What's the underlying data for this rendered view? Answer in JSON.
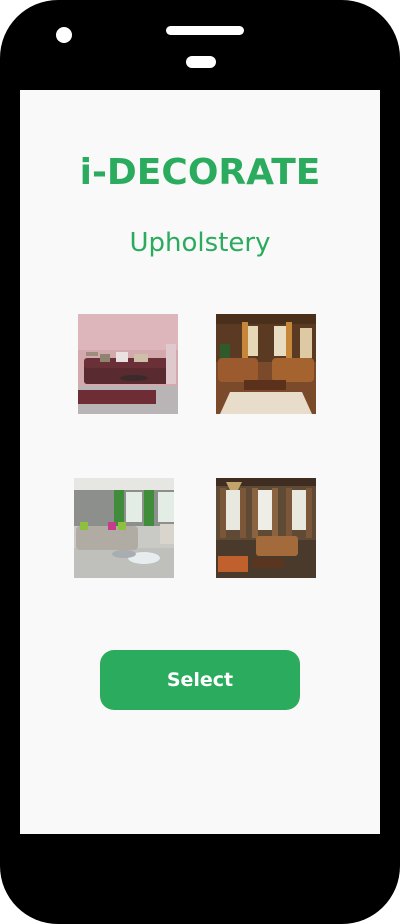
{
  "app": {
    "title": "i-DECORATE",
    "subtitle": "Upholstery"
  },
  "gallery": {
    "items": [
      {
        "icon": "pink-living-room-image"
      },
      {
        "icon": "leather-sofa-room-image"
      },
      {
        "icon": "green-accent-living-room-image"
      },
      {
        "icon": "classic-drapes-room-image"
      }
    ]
  },
  "actions": {
    "select_label": "Select"
  },
  "colors": {
    "accent": "#2bab5e",
    "screen_bg": "#f9f9f9",
    "device": "#000000"
  }
}
